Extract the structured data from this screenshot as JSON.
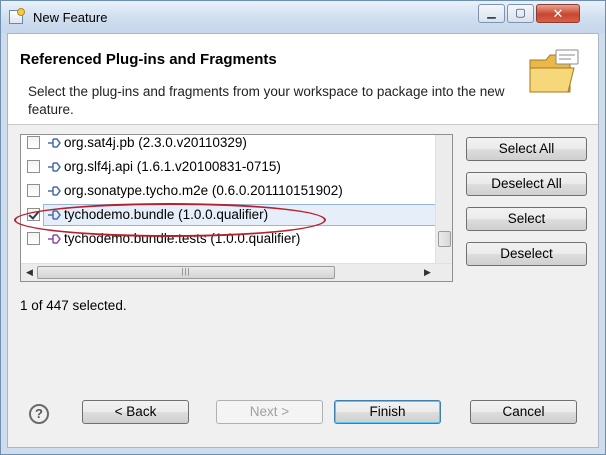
{
  "window": {
    "title": "New Feature"
  },
  "header": {
    "title": "Referenced Plug-ins and Fragments",
    "description": "Select the plug-ins and fragments from your workspace to package into the new feature."
  },
  "list": {
    "items": [
      {
        "label": "org.sat4j.pb (2.3.0.v20110329)",
        "checked": false
      },
      {
        "label": "org.slf4j.api (1.6.1.v20100831-0715)",
        "checked": false
      },
      {
        "label": "org.sonatype.tycho.m2e (0.6.0.201110151902)",
        "checked": false
      },
      {
        "label": "tychodemo.bundle (1.0.0.qualifier)",
        "checked": true,
        "selected": true
      },
      {
        "label": "tychodemo.bundle.tests (1.0.0.qualifier)",
        "checked": false
      }
    ]
  },
  "side_buttons": {
    "select_all": "Select All",
    "deselect_all": "Deselect All",
    "select": "Select",
    "deselect": "Deselect"
  },
  "status": "1 of 447 selected.",
  "footer": {
    "help": "?",
    "back": "< Back",
    "next": "Next >",
    "finish": "Finish",
    "cancel": "Cancel"
  },
  "colors": {
    "highlight_ring": "#b5222d",
    "selection_bg": "#e6eef9"
  }
}
